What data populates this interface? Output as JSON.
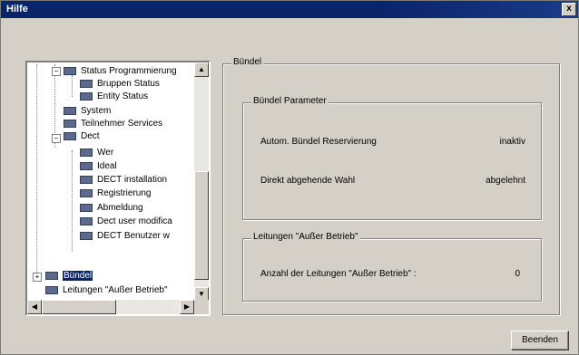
{
  "window": {
    "title": "Hilfe",
    "close_glyph": "x"
  },
  "tree": {
    "items": [
      {
        "label": "Status Programmierung",
        "indent": 2
      },
      {
        "label": "Bruppen Status",
        "indent": 3
      },
      {
        "label": "Entity Status",
        "indent": 3
      },
      {
        "label": "System",
        "indent": 2
      },
      {
        "label": "Teilnehmer Services",
        "indent": 2
      },
      {
        "label": "Dect",
        "indent": 2
      },
      {
        "label": "Wer",
        "indent": 3
      },
      {
        "label": "Ideal",
        "indent": 3
      },
      {
        "label": "DECT installation",
        "indent": 3
      },
      {
        "label": "Registrierung",
        "indent": 3
      },
      {
        "label": "Abmeldung",
        "indent": 3
      },
      {
        "label": "Dect user modifica",
        "indent": 3
      },
      {
        "label": "DECT Benutzer w",
        "indent": 3
      },
      {
        "label": "Bündel",
        "indent": 1,
        "selected": true
      },
      {
        "label": "Leitungen \"Außer Betrieb\"",
        "indent": 1
      }
    ]
  },
  "panel": {
    "main_group_title": "Bündel",
    "params_group_title": "Bündel Parameter",
    "auto_label": "Autom. Bündel Reservierung",
    "auto_value": "inaktiv",
    "direct_label": "Direkt abgehende Wahl",
    "direct_value": "abgelehnt",
    "lines_group_title": "Leitungen \"Außer Betrieb\"",
    "lines_label": "Anzahl der Leitungen \"Außer Betrieb\" :",
    "lines_value": "0"
  },
  "buttons": {
    "close_label": "Beenden"
  }
}
